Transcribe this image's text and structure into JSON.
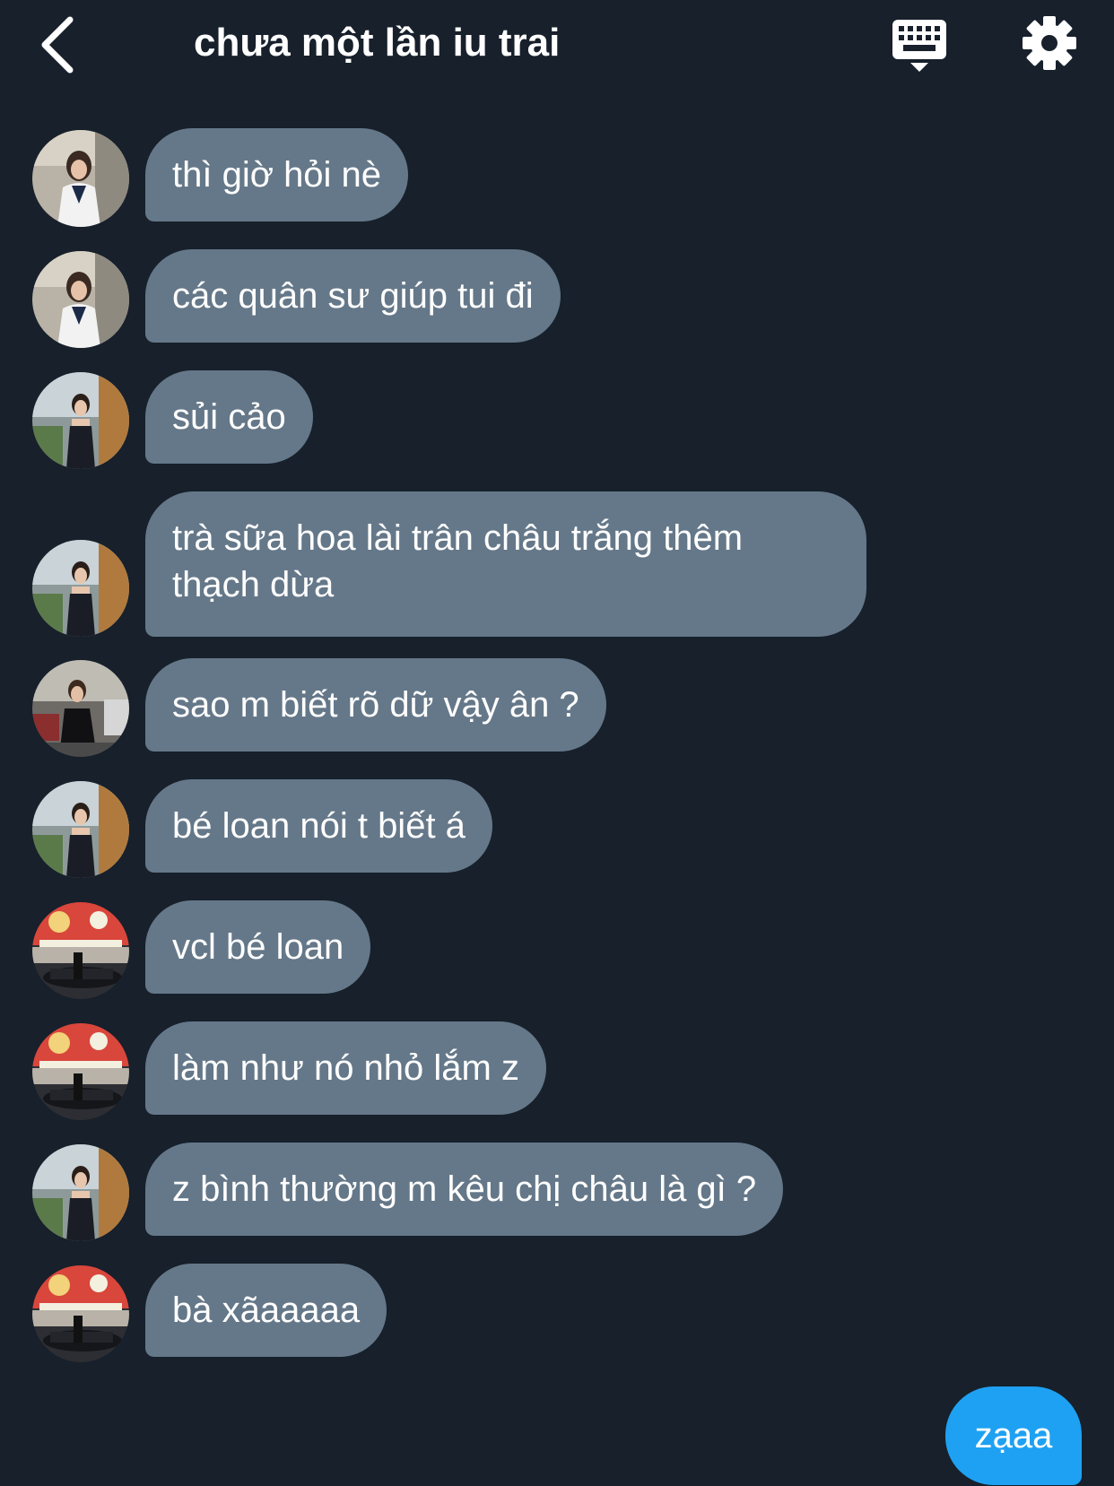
{
  "header": {
    "title": "chưa một lần iu trai",
    "back_icon": "chevron-left-icon",
    "keyboard_icon": "keyboard-icon",
    "settings_icon": "gear-icon"
  },
  "colors": {
    "background": "#17202b",
    "incoming_bubble": "#657889",
    "outgoing_bubble": "#1ea1f2",
    "text": "#ffffff"
  },
  "messages": [
    {
      "sender": "A",
      "text": "thì giờ hỏi nè"
    },
    {
      "sender": "A",
      "text": "các quân sư giúp tui đi"
    },
    {
      "sender": "B",
      "text": "sủi cảo"
    },
    {
      "sender": "B",
      "text": "trà sữa hoa lài trân châu trắng thêm thạch dừa"
    },
    {
      "sender": "C",
      "text": "sao m biết rõ dữ vậy ân ?"
    },
    {
      "sender": "B",
      "text": "bé loan nói t biết á"
    },
    {
      "sender": "D",
      "text": "vcl bé loan"
    },
    {
      "sender": "D",
      "text": "làm như nó nhỏ lắm z"
    },
    {
      "sender": "B",
      "text": "z bình thường m kêu chị châu là gì ?"
    },
    {
      "sender": "D",
      "text": "bà xãaaaaa"
    }
  ],
  "outgoing": {
    "text": "zạaa"
  }
}
